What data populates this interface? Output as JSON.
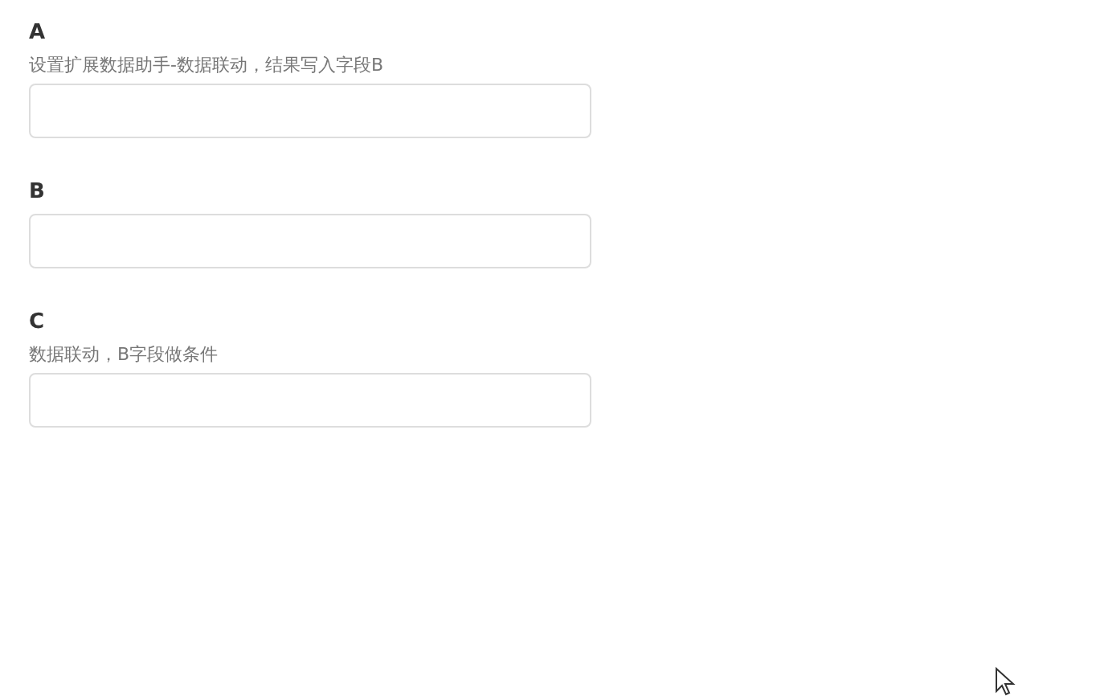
{
  "fields": [
    {
      "label": "A",
      "description": "设置扩展数据助手-数据联动，结果写入字段B"
    },
    {
      "label": "B"
    },
    {
      "label": "C",
      "description": "数据联动，B字段做条件"
    }
  ]
}
